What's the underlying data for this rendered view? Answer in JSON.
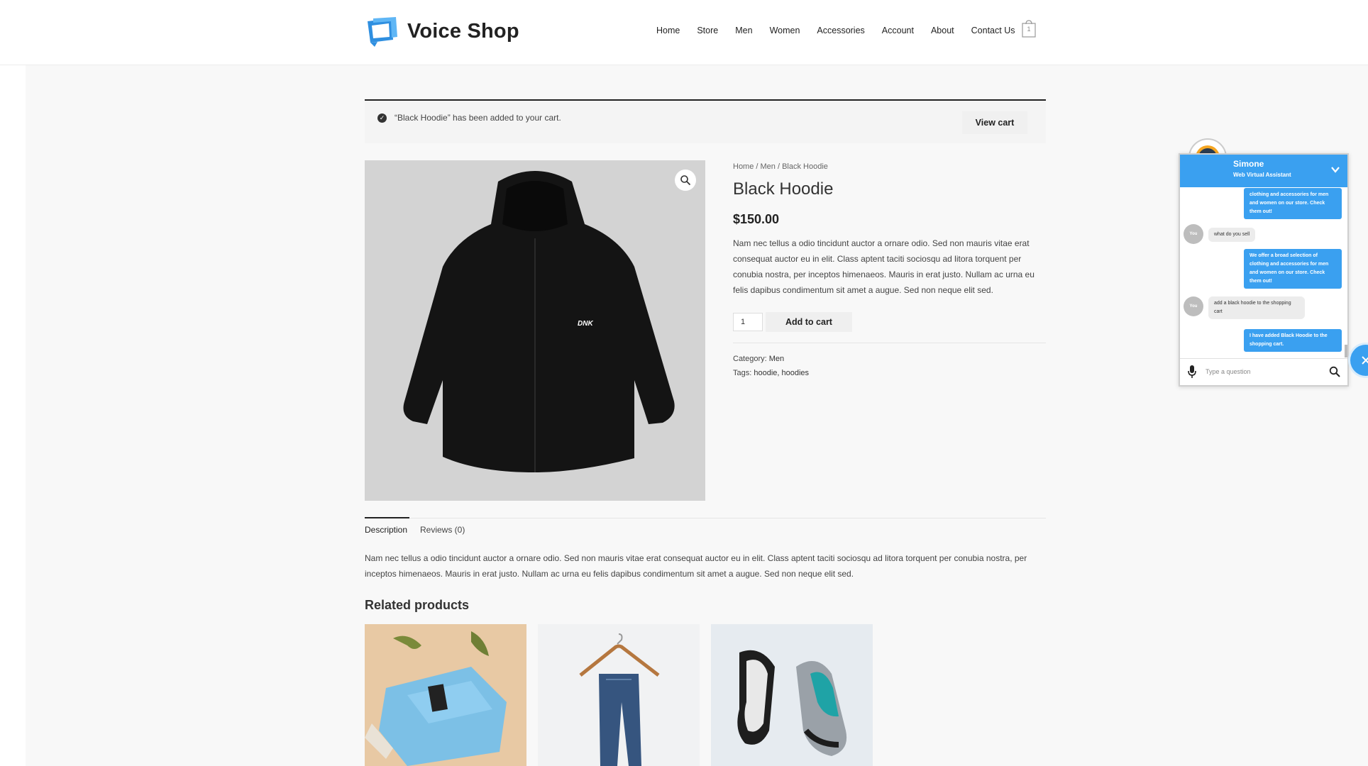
{
  "site": {
    "logo_text": "Voice Shop",
    "nav": [
      "Home",
      "Store",
      "Men",
      "Women",
      "Accessories",
      "Account",
      "About",
      "Contact Us"
    ],
    "cart_count": "1"
  },
  "notice": {
    "message": "“Black Hoodie” has been added to your cart.",
    "view_cart": "View cart"
  },
  "product": {
    "breadcrumb": "Home / Men / Black Hoodie",
    "title": "Black Hoodie",
    "price": "$150.00",
    "description": "Nam nec tellus a odio tincidunt auctor a ornare odio. Sed non mauris vitae erat consequat auctor eu in elit. Class aptent taciti sociosqu ad litora torquent per conubia nostra, per inceptos himenaeos. Mauris in erat justo. Nullam ac urna eu felis dapibus condimentum sit amet a augue. Sed non neque elit sed.",
    "quantity": "1",
    "add_to_cart": "Add to cart",
    "category_label": "Category:",
    "category": "Men",
    "tags_label": "Tags:",
    "tags": "hoodie, hoodies",
    "image_brand": "DNK"
  },
  "tabs": {
    "description": "Description",
    "reviews": "Reviews (0)"
  },
  "description_text": "Nam nec tellus a odio tincidunt auctor a ornare odio. Sed non mauris vitae erat consequat auctor eu in elit. Class aptent taciti sociosqu ad litora torquent per conubia nostra, per inceptos himenaeos. Mauris in erat justo. Nullam ac urna eu felis dapibus condimentum sit amet a augue. Sed non neque elit sed.",
  "related_title": "Related products",
  "chat": {
    "name": "Simone",
    "role": "Web Virtual Assistant",
    "accent": "#3aa0f0",
    "you_label": "You",
    "messages": [
      {
        "from": "bot",
        "text": "clothing and accessories for men and women on our store. Check them out!"
      },
      {
        "from": "user",
        "text": "what do you sell"
      },
      {
        "from": "bot",
        "text": "We offer a broad selection of clothing and accessories for men and women on our store. Check them out!"
      },
      {
        "from": "user",
        "text": "add a black hoodie to the shopping cart"
      },
      {
        "from": "bot",
        "text": "I have added Black Hoodie to the shopping cart."
      }
    ],
    "input_placeholder": "Type a question"
  }
}
